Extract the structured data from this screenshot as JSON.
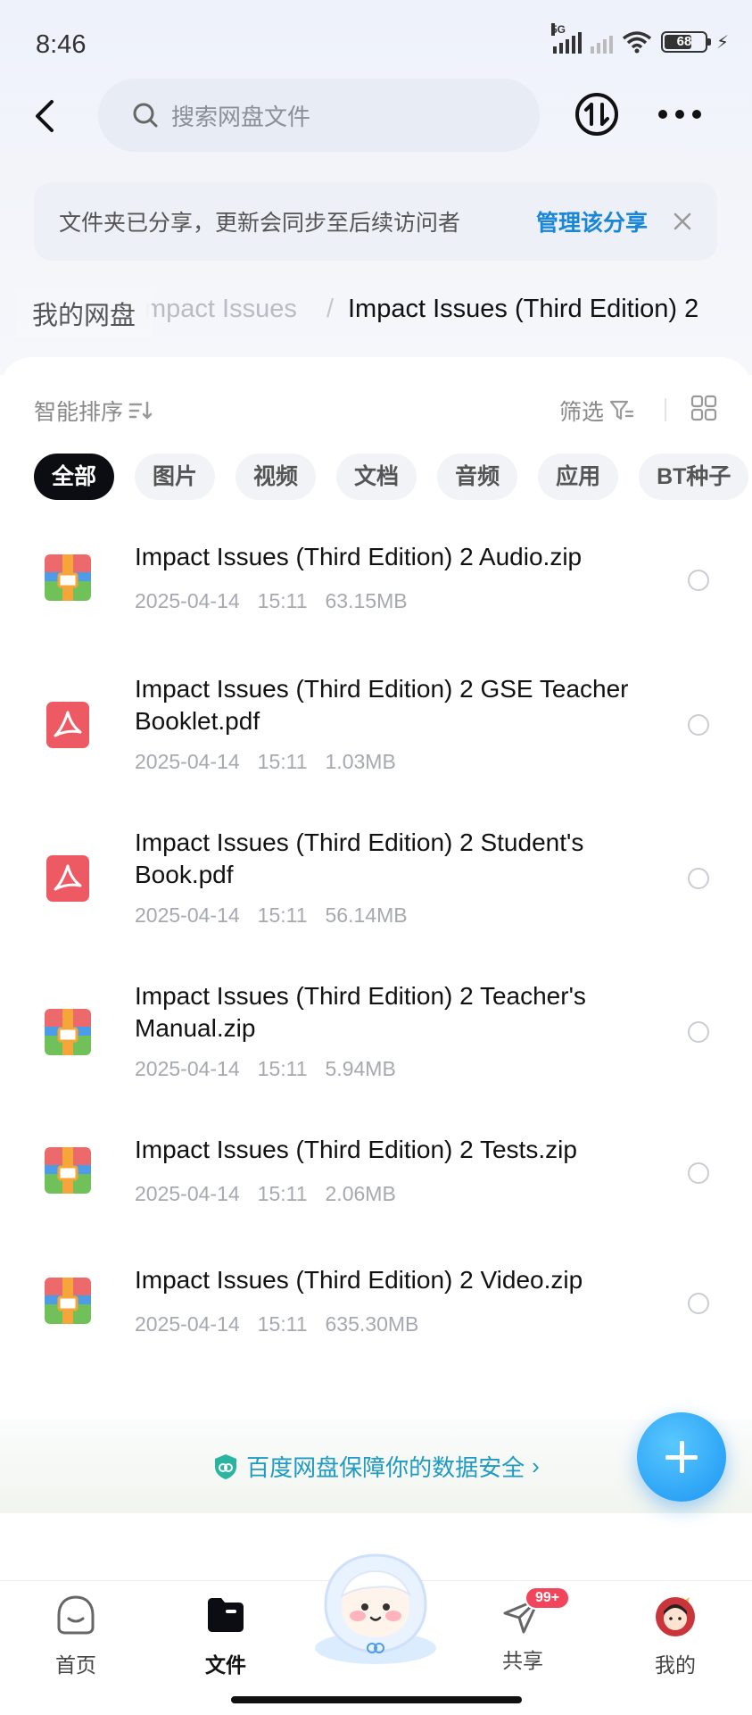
{
  "status_bar": {
    "time": "8:46",
    "network": "5G",
    "battery": "68"
  },
  "search": {
    "placeholder": "搜索网盘文件"
  },
  "banner": {
    "message": "文件夹已分享，更新会同步至后续访问者",
    "action": "管理该分享"
  },
  "breadcrumb": {
    "root": "我的网盘",
    "parent": "mpact Issues",
    "separator": "/",
    "current": "Impact Issues (Third Edition) 2"
  },
  "toolbar": {
    "sort_label": "智能排序",
    "filter_label": "筛选"
  },
  "chips": [
    "全部",
    "图片",
    "视频",
    "文档",
    "音频",
    "应用",
    "BT种子"
  ],
  "files": [
    {
      "name": "Impact Issues (Third Edition) 2 Audio.zip",
      "date": "2025-04-14",
      "time": "15:11",
      "size": "63.15MB",
      "type": "zip-icon"
    },
    {
      "name": "Impact Issues (Third Edition) 2 GSE Teacher Booklet.pdf",
      "date": "2025-04-14",
      "time": "15:11",
      "size": "1.03MB",
      "type": "pdf-icon"
    },
    {
      "name": "Impact Issues (Third Edition) 2 Student's Book.pdf",
      "date": "2025-04-14",
      "time": "15:11",
      "size": "56.14MB",
      "type": "pdf-icon"
    },
    {
      "name": "Impact Issues (Third Edition) 2 Teacher's Manual.zip",
      "date": "2025-04-14",
      "time": "15:11",
      "size": "5.94MB",
      "type": "zip-icon"
    },
    {
      "name": "Impact Issues (Third Edition) 2 Tests.zip",
      "date": "2025-04-14",
      "time": "15:11",
      "size": "2.06MB",
      "type": "zip-icon"
    },
    {
      "name": "Impact Issues (Third Edition) 2 Video.zip",
      "date": "2025-04-14",
      "time": "15:11",
      "size": "635.30MB",
      "type": "zip-icon"
    }
  ],
  "security": {
    "text": "百度网盘保障你的数据安全",
    "chevron": "›"
  },
  "tabs": [
    {
      "label": "首页",
      "icon": "home-icon"
    },
    {
      "label": "文件",
      "icon": "folder-icon"
    },
    {
      "label": "共享",
      "icon": "send-icon",
      "badge": "99+"
    },
    {
      "label": "我的",
      "icon": "avatar"
    }
  ],
  "colors": {
    "accent": "#1a86d8",
    "fab": "#1b95f2",
    "badge": "#f2445a"
  }
}
